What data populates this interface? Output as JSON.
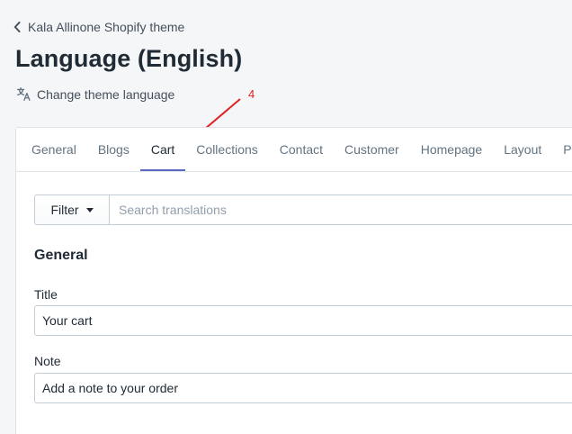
{
  "breadcrumb": {
    "label": "Kala Allinone Shopify theme"
  },
  "page": {
    "title": "Language (English)"
  },
  "change_language": {
    "label": "Change theme language"
  },
  "annotation": {
    "number": "4",
    "color": "#e02020"
  },
  "tabs": [
    {
      "label": "General",
      "active": false
    },
    {
      "label": "Blogs",
      "active": false
    },
    {
      "label": "Cart",
      "active": true
    },
    {
      "label": "Collections",
      "active": false
    },
    {
      "label": "Contact",
      "active": false
    },
    {
      "label": "Customer",
      "active": false
    },
    {
      "label": "Homepage",
      "active": false
    },
    {
      "label": "Layout",
      "active": false
    },
    {
      "label": "Products",
      "active": false
    }
  ],
  "filter": {
    "button_label": "Filter",
    "search_placeholder": "Search translations"
  },
  "section": {
    "title": "General",
    "fields": [
      {
        "label": "Title",
        "value": "Your cart"
      },
      {
        "label": "Note",
        "value": "Add a note to your order"
      }
    ]
  },
  "colors": {
    "accent": "#5c6ac4",
    "text": "#212b36",
    "muted": "#637381"
  }
}
